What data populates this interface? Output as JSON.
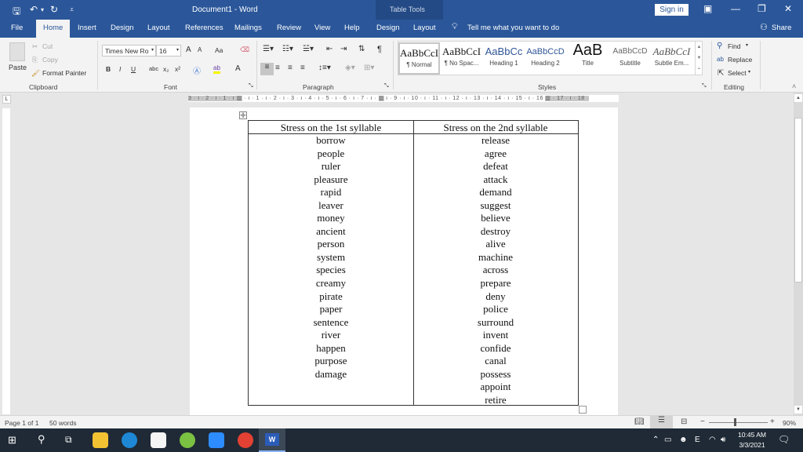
{
  "window": {
    "title": "Document1  -  Word",
    "contextual_title": "Table Tools",
    "sign_in": "Sign in",
    "controls": {
      "ribbon_display": "▣",
      "minimize": "—",
      "restore": "❐",
      "close": "✕"
    }
  },
  "quick_access": {
    "save": "🖫",
    "undo": "↶",
    "undo_dropdown": "▾",
    "redo": "↻",
    "customize": "⩡"
  },
  "tabs": [
    {
      "label": "File"
    },
    {
      "label": "Home",
      "active": true
    },
    {
      "label": "Insert"
    },
    {
      "label": "Design"
    },
    {
      "label": "Layout"
    },
    {
      "label": "References"
    },
    {
      "label": "Mailings"
    },
    {
      "label": "Review"
    },
    {
      "label": "View"
    },
    {
      "label": "Help"
    },
    {
      "label": "Design"
    },
    {
      "label": "Layout"
    }
  ],
  "tell_me": "Tell me what you want to do",
  "share": "Share",
  "ribbon": {
    "clipboard": {
      "label": "Clipboard",
      "paste": "Paste",
      "cut": "Cut",
      "copy": "Copy",
      "format_painter": "Format Painter"
    },
    "font": {
      "label": "Font",
      "font_name": "Times New Ro",
      "font_size": "16",
      "grow": "A",
      "shrink": "A",
      "change_case": "Aa",
      "bold": "B",
      "italic": "I",
      "underline": "U",
      "strike": "abc",
      "subscript": "x₂",
      "superscript": "x²",
      "font_color": "A"
    },
    "paragraph": {
      "label": "Paragraph",
      "pilcrow": "¶"
    },
    "styles": {
      "label": "Styles",
      "items": [
        {
          "preview": "AaBbCcI",
          "name": "¶ Normal"
        },
        {
          "preview": "AaBbCcI",
          "name": "¶ No Spac..."
        },
        {
          "preview": "AaBbCc",
          "name": "Heading 1"
        },
        {
          "preview": "AaBbCcD",
          "name": "Heading 2"
        },
        {
          "preview": "AaB",
          "name": "Title"
        },
        {
          "preview": "AaBbCcD",
          "name": "Subtitle"
        },
        {
          "preview": "AaBbCcI",
          "name": "Subtle Em..."
        }
      ]
    },
    "editing": {
      "label": "Editing",
      "find": "Find",
      "replace": "Replace",
      "select": "Select"
    }
  },
  "ruler": {
    "left": "3 · ı · 2 · ı · 1 · ı ",
    "body": " · ı · 1 · ı · 2 · ı · 3 · ı · 4 · ı · 5 · ı · 6 · ı · 7 · ı · ",
    "body2": " ı · 9 · ı · 10 · ı · 11 · ı · 12 · ı · 13 · ı · 14 · ı · 15 · ı · 16 ",
    "right": " · 17 · ı · 18 ·"
  },
  "document": {
    "table": {
      "headers": [
        "Stress on the 1st syllable",
        "Stress on the 2nd syllable"
      ],
      "col1": [
        "borrow",
        "people",
        "ruler",
        "pleasure",
        "rapid",
        "leaver",
        "money",
        "ancient",
        "person",
        "system",
        "species",
        "creamy",
        "pirate",
        "paper",
        "sentence",
        "river",
        "happen",
        "purpose",
        "damage"
      ],
      "col2": [
        "release",
        "agree",
        "defeat",
        "attack",
        "demand",
        "suggest",
        "believe",
        "destroy",
        "alive",
        "machine",
        "across",
        "prepare",
        "deny",
        "police",
        "surround",
        "invent",
        "confide",
        "canal",
        "possess",
        "appoint",
        "retire"
      ]
    }
  },
  "status": {
    "page": "Page 1 of 1",
    "words": "50 words",
    "zoom": "90%",
    "zoom_level_percent": 90
  },
  "taskbar": {
    "time": "10:45 AM",
    "date": "3/3/2021"
  }
}
